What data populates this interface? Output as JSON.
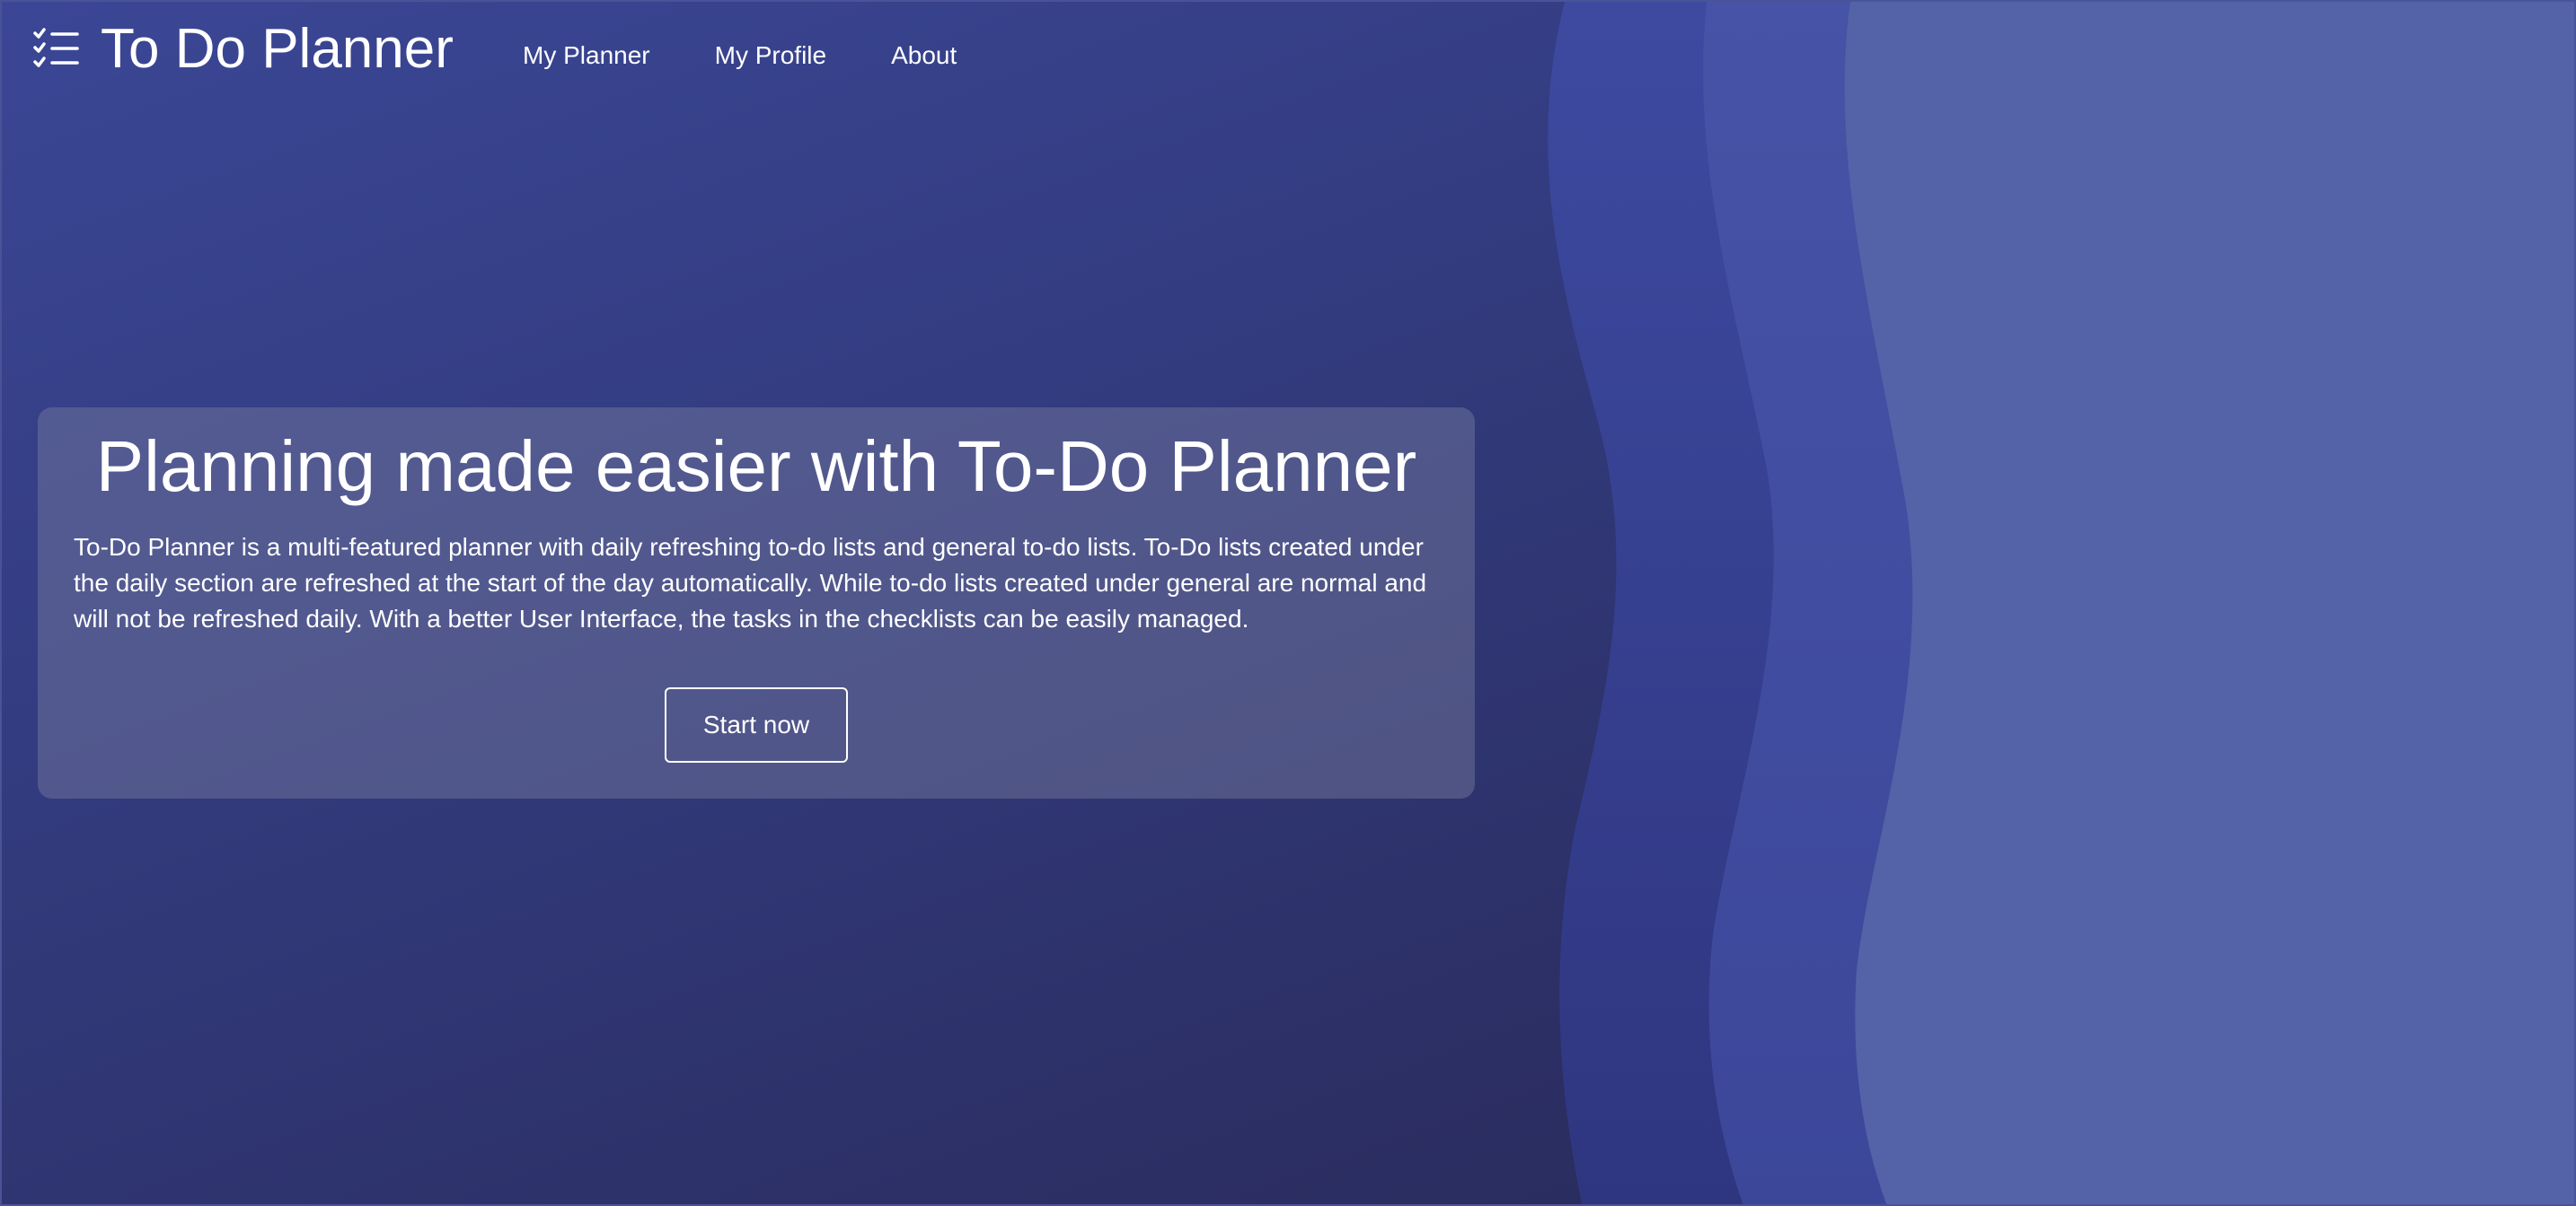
{
  "brand": {
    "icon": "checklist-icon",
    "title": "To Do Planner"
  },
  "nav": {
    "items": [
      {
        "label": "My Planner"
      },
      {
        "label": "My Profile"
      },
      {
        "label": "About"
      }
    ]
  },
  "hero": {
    "title": "Planning made easier with To-Do Planner",
    "description": "To-Do Planner is a multi-featured planner with daily refreshing to-do lists and general to-do lists. To-Do lists created under the daily section are refreshed at the start of the day automatically. While to-do lists created under general are normal and will not be refreshed daily. With a better User Interface, the tasks in the checklists can be easily managed.",
    "cta_label": "Start now"
  },
  "colors": {
    "background_top": "#3b4796",
    "background_bottom": "#262955",
    "wave_dark": "#39449a",
    "wave_mid": "#4350a0",
    "wave_light": "#5463a8"
  }
}
